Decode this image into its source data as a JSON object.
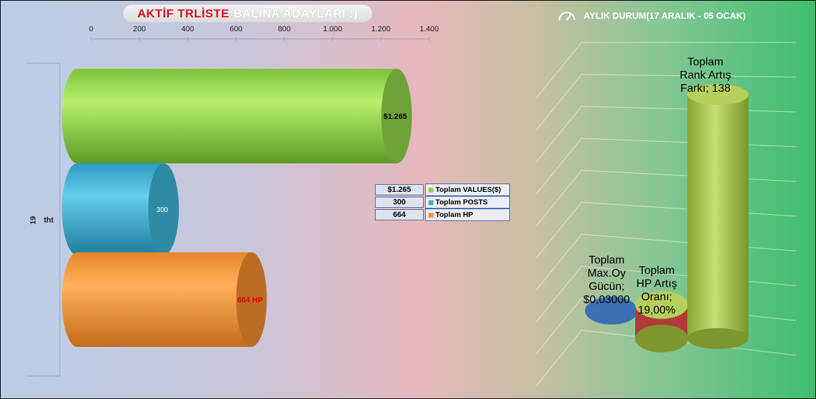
{
  "title": {
    "part1": "AKTİF TRLİSTE",
    "part2": "BALİNA  ADAYLARI  :)"
  },
  "right_title": {
    "text": "AYLIK DURUM(17 ARALIK - 05 OCAK)",
    "icon": "gauge-icon"
  },
  "chart_data": [
    {
      "type": "bar",
      "orientation": "horizontal",
      "title": "AKTİF TRLİSTE BALİNA ADAYLARI :)",
      "xlim": [
        0,
        1400
      ],
      "x_ticks": [
        "0",
        "200",
        "400",
        "600",
        "800",
        "1.000",
        "1.200",
        "1.400"
      ],
      "categories": [
        "19 tht"
      ],
      "category_parts": [
        "19",
        "tht"
      ],
      "series": [
        {
          "name": "Toplam VALUES($)",
          "value": 1265,
          "label": "$1.265",
          "legend_value": "$1.265",
          "color": "#8fd44a"
        },
        {
          "name": "Toplam POSTS",
          "value": 300,
          "label": "300",
          "legend_value": "300",
          "color": "#3fb3d6"
        },
        {
          "name": "Toplam HP",
          "value": 664,
          "label": "664 HP",
          "legend_value": "664",
          "color": "#f7953a"
        }
      ],
      "legend": "table-right"
    },
    {
      "type": "bar",
      "style": "3d-cylinder",
      "title": "AYLIK DURUM(17 ARALIK - 05 OCAK)",
      "series": [
        {
          "name": "Toplam Max.Oy Gücün",
          "value": 0.03,
          "label_lines": [
            "Toplam",
            "Max.Oy",
            "Gücün;",
            "$0,03000"
          ],
          "color": "#3d6fb5"
        },
        {
          "name": "Toplam HP Artış Oranı",
          "value": 19,
          "label_lines": [
            "Toplam",
            "HP Artış",
            "Oranı;",
            "19,00%"
          ],
          "color": "#c0393b"
        },
        {
          "name": "Toplam Rank Artış Farkı",
          "value": 138,
          "label_lines": [
            "Toplam",
            "Rank Artış",
            "Farkı; 138"
          ],
          "color": "#a8c84a"
        }
      ]
    }
  ]
}
